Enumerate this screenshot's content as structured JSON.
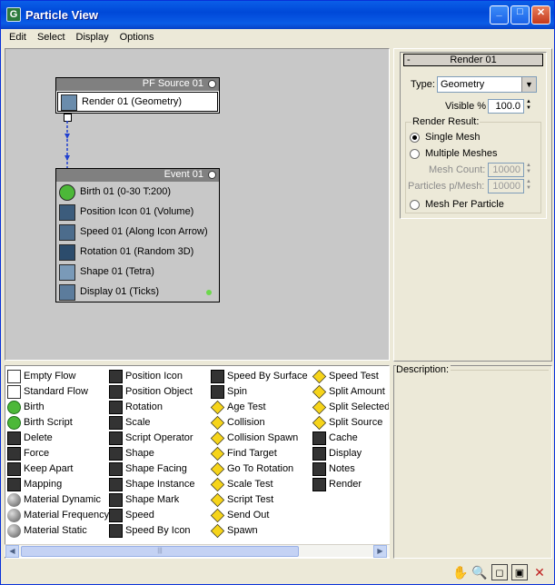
{
  "window": {
    "title": "Particle View",
    "app_icon": "G"
  },
  "menu": [
    "Edit",
    "Select",
    "Display",
    "Options"
  ],
  "graph": {
    "source_node": {
      "title": "PF Source 01",
      "operators": [
        "Render 01 (Geometry)"
      ]
    },
    "event_node": {
      "title": "Event 01",
      "operators": [
        "Birth 01 (0-30 T:200)",
        "Position Icon 01 (Volume)",
        "Speed 01 (Along Icon Arrow)",
        "Rotation 01 (Random 3D)",
        "Shape 01 (Tetra)",
        "Display 01 (Ticks)"
      ]
    }
  },
  "properties": {
    "rollout_title": "Render 01",
    "rollout_toggle": "-",
    "type_label": "Type:",
    "type_value": "Geometry",
    "visible_label": "Visible %",
    "visible_value": "100.0",
    "render_result_label": "Render Result:",
    "single_mesh": "Single Mesh",
    "multiple_meshes": "Multiple Meshes",
    "mesh_count_label": "Mesh Count:",
    "mesh_count_value": "10000",
    "particles_per_mesh_label": "Particles p/Mesh:",
    "particles_per_mesh_value": "10000",
    "mesh_per_particle": "Mesh Per Particle"
  },
  "depot": {
    "columns": [
      [
        {
          "label": "Empty Flow",
          "icon": "flow-icon"
        },
        {
          "label": "Standard Flow",
          "icon": "flow-icon"
        },
        {
          "label": "Birth",
          "icon": "birth-icon"
        },
        {
          "label": "Birth Script",
          "icon": "birth-script-icon"
        },
        {
          "label": "Delete",
          "icon": "delete-icon"
        },
        {
          "label": "Force",
          "icon": "force-icon"
        },
        {
          "label": "Keep Apart",
          "icon": "keep-apart-icon"
        },
        {
          "label": "Mapping",
          "icon": "mapping-icon"
        },
        {
          "label": "Material Dynamic",
          "icon": "material-icon"
        },
        {
          "label": "Material Frequency",
          "icon": "material-icon"
        },
        {
          "label": "Material Static",
          "icon": "material-icon"
        }
      ],
      [
        {
          "label": "Position Icon",
          "icon": "position-icon"
        },
        {
          "label": "Position Object",
          "icon": "position-object-icon"
        },
        {
          "label": "Rotation",
          "icon": "rotation-icon"
        },
        {
          "label": "Scale",
          "icon": "scale-icon"
        },
        {
          "label": "Script Operator",
          "icon": "script-icon"
        },
        {
          "label": "Shape",
          "icon": "shape-icon"
        },
        {
          "label": "Shape Facing",
          "icon": "shape-facing-icon"
        },
        {
          "label": "Shape Instance",
          "icon": "shape-instance-icon"
        },
        {
          "label": "Shape Mark",
          "icon": "shape-mark-icon"
        },
        {
          "label": "Speed",
          "icon": "speed-icon"
        },
        {
          "label": "Speed By Icon",
          "icon": "speed-icon"
        }
      ],
      [
        {
          "label": "Speed By Surface",
          "icon": "speed-icon"
        },
        {
          "label": "Spin",
          "icon": "spin-icon"
        },
        {
          "label": "Age Test",
          "icon": "test-icon"
        },
        {
          "label": "Collision",
          "icon": "test-icon"
        },
        {
          "label": "Collision Spawn",
          "icon": "test-icon"
        },
        {
          "label": "Find Target",
          "icon": "test-icon"
        },
        {
          "label": "Go To Rotation",
          "icon": "test-icon"
        },
        {
          "label": "Scale Test",
          "icon": "test-icon"
        },
        {
          "label": "Script Test",
          "icon": "script-test-icon"
        },
        {
          "label": "Send Out",
          "icon": "test-icon"
        },
        {
          "label": "Spawn",
          "icon": "test-icon"
        }
      ],
      [
        {
          "label": "Speed Test",
          "icon": "test-icon"
        },
        {
          "label": "Split Amount",
          "icon": "test-icon"
        },
        {
          "label": "Split Selected",
          "icon": "test-icon"
        },
        {
          "label": "Split Source",
          "icon": "test-icon"
        },
        {
          "label": "Cache",
          "icon": "cache-icon"
        },
        {
          "label": "Display",
          "icon": "display-icon"
        },
        {
          "label": "Notes",
          "icon": "notes-icon"
        },
        {
          "label": "Render",
          "icon": "render-icon"
        }
      ]
    ]
  },
  "description": {
    "label": "Description:"
  },
  "statusbar_icons": [
    "pan-icon",
    "zoom-icon",
    "zoom-region-icon",
    "zoom-extents-icon",
    "no-zoom-icon"
  ]
}
